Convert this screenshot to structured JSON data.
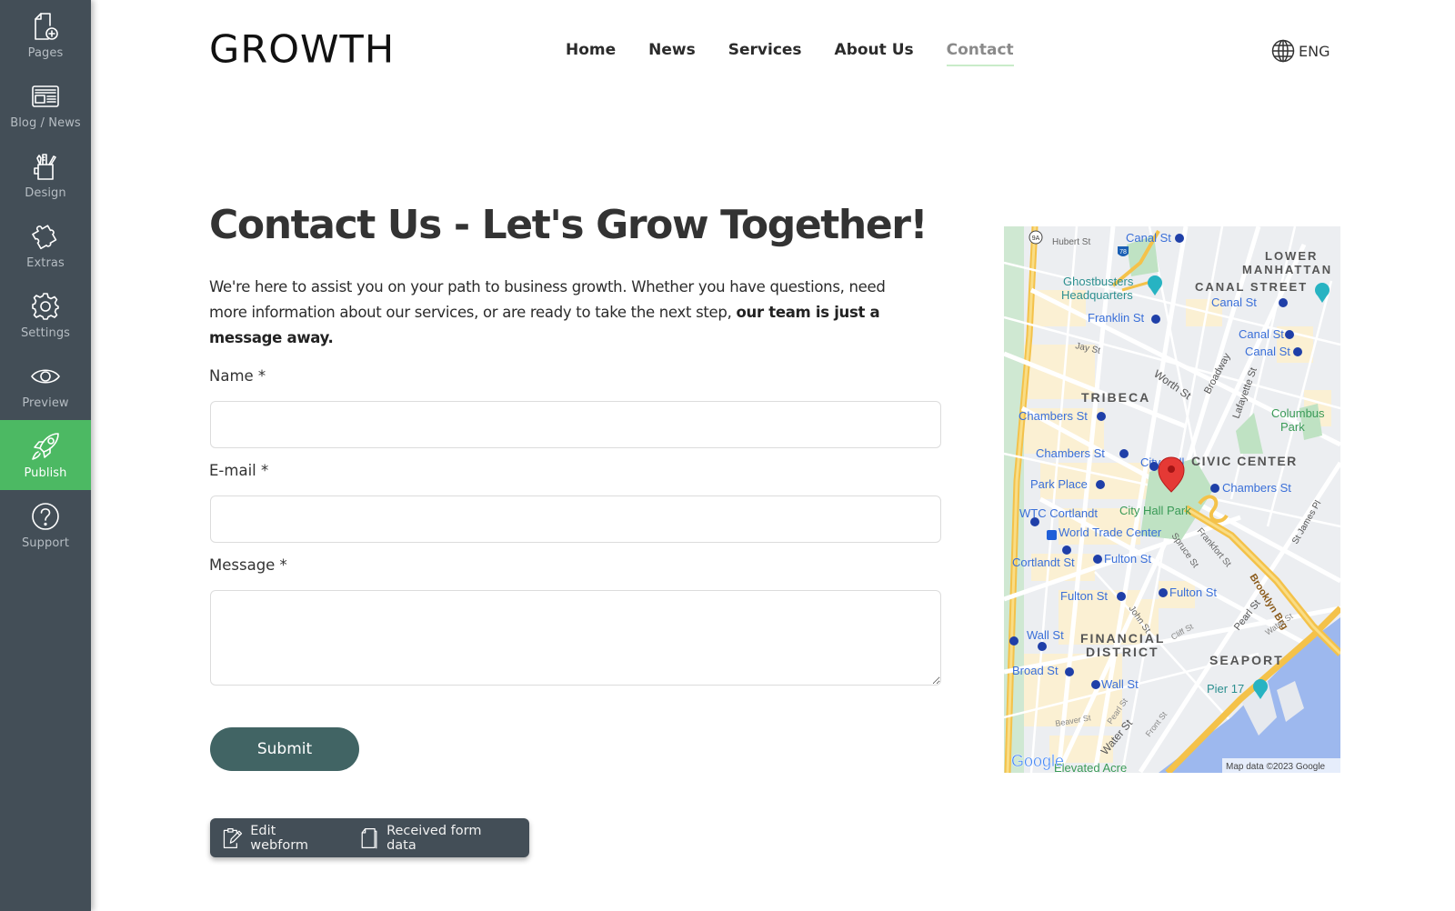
{
  "sidebar": {
    "items": [
      {
        "label": "Pages",
        "icon": "page-add-icon"
      },
      {
        "label": "Blog / News",
        "icon": "newspaper-icon"
      },
      {
        "label": "Design",
        "icon": "design-tools-icon"
      },
      {
        "label": "Extras",
        "icon": "puzzle-icon"
      },
      {
        "label": "Settings",
        "icon": "gear-icon"
      },
      {
        "label": "Preview",
        "icon": "eye-icon"
      },
      {
        "label": "Publish",
        "icon": "rocket-icon",
        "active": true
      },
      {
        "label": "Support",
        "icon": "help-icon"
      }
    ],
    "active_color": "#4cb963",
    "bg_color": "#434e57"
  },
  "header": {
    "logo": "GROWTH",
    "nav": [
      {
        "label": "Home"
      },
      {
        "label": "News"
      },
      {
        "label": "Services"
      },
      {
        "label": "About Us"
      },
      {
        "label": "Contact",
        "current": true
      }
    ],
    "language": "ENG"
  },
  "main": {
    "title": "Contact Us - Let's Grow Together!",
    "intro_text": "We're here to assist you on your path to business growth. Whether you have questions, need more information about our services, or are ready to take the next step, ",
    "intro_bold": "our team is just a message away.",
    "form": {
      "name_label": "Name *",
      "name_value": "",
      "email_label": "E-mail *",
      "email_value": "",
      "message_label": "Message *",
      "message_value": "",
      "submit_label": "Submit",
      "submit_color": "#416464"
    },
    "edit_bar": {
      "edit_label": "Edit webform",
      "received_label": "Received form data"
    }
  },
  "map": {
    "attribution": "Map data ©2023 Google",
    "brand": "Google",
    "neighborhoods": [
      "LOWER MANHATTAN",
      "CANAL STREET",
      "TRIBECA",
      "CIVIC CENTER",
      "FINANCIAL DISTRICT",
      "SEAPORT"
    ],
    "labels": {
      "hubert": "Hubert St",
      "canal1": "Canal St",
      "ghost1": "Ghostbusters",
      "ghost2": "Headquarters",
      "lower1": "LOWER",
      "lower2": "MANHATTAN",
      "canalstreet": "CANAL STREET",
      "canal2": "Canal St",
      "franklin": "Franklin St",
      "canal3": "Canal St",
      "canal4": "Canal St",
      "jay": "Jay St",
      "worth": "Worth St",
      "broadway": "Broadway",
      "lafayette": "Lafayette St",
      "tribeca": "TRIBECA",
      "chambers1": "Chambers St",
      "columbus1": "Columbus",
      "columbus2": "Park",
      "chambers2": "Chambers St",
      "cityhall": "City Hall",
      "civic": "CIVIC CENTER",
      "parkplace": "Park Place",
      "chambers3": "Chambers St",
      "wtccortlandt": "WTC Cortlandt",
      "cityhallpark": "City Hall Park",
      "wtc": "World Trade Center",
      "spruce": "Spruce St",
      "frankfort": "Frankfort St",
      "stjames": "St James Pl",
      "cortlandt": "Cortlandt St",
      "fulton1": "Fulton St",
      "fulton2": "Fulton St",
      "fulton3": "Fulton St",
      "john": "John St",
      "brooklyn": "Brooklyn Brg",
      "pearl1": "Pearl St",
      "water1": "Water St",
      "cliff": "Cliff St",
      "wall1": "Wall St",
      "financial1": "FINANCIAL",
      "financial2": "DISTRICT",
      "seaport": "SEAPORT",
      "broad": "Broad St",
      "wall2": "Wall St",
      "pier": "Pier 17",
      "beaver": "Beaver St",
      "pearl2": "Pearl St",
      "water2": "Water St",
      "front": "Front St",
      "elevated": "Elevated Acre",
      "route9a": "9A",
      "route78": "78"
    }
  }
}
